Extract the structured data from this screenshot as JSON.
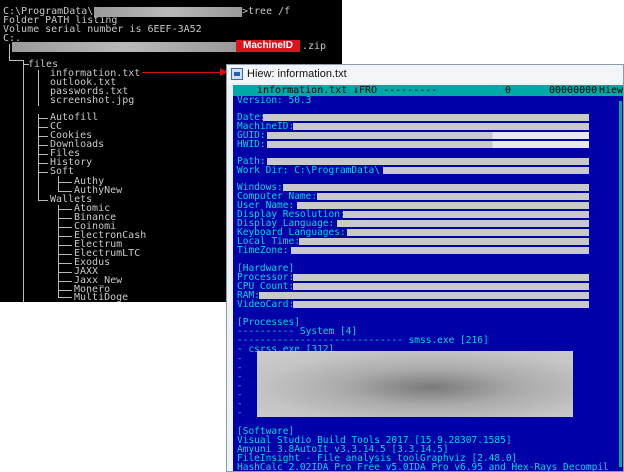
{
  "console": {
    "cmd_prefix": "C:\\ProgramData\\",
    "cmd_suffix": ">tree /f",
    "line1": "Folder PATH listing",
    "line2": "Volume serial number is 6EEF-3A52",
    "line3": "C:.",
    "zip_suffix": ".zip",
    "machineid_label": "MachineID",
    "tree": {
      "files": "files",
      "files_children": [
        "information.txt",
        "outlook.txt",
        "passwords.txt",
        "screenshot.jpg"
      ],
      "dirs": [
        "Autofill",
        "CC",
        "Cookies",
        "Downloads",
        "Files",
        "History",
        "Soft"
      ],
      "soft_children": [
        "Authy",
        "AuthyNew"
      ],
      "wallets": "Wallets",
      "wallets_children": [
        "Atomic",
        "Binance",
        "Coinomi",
        "ElectronCash",
        "Electrum",
        "ElectrumLTC",
        "Exodus",
        "JAXX",
        "Jaxx_New",
        "Monero",
        "MultiDoge"
      ]
    }
  },
  "hiew": {
    "window_title": "Hiew: information.txt",
    "status": {
      "filename": "information.txt",
      "mode": "↓FRO ---------",
      "zero": "0",
      "offset": "00000000",
      "app": "Hiew"
    },
    "version_line": "Version: 50.3",
    "date_label": "Date:",
    "machineid_label": "MachineID:",
    "guid_label": "GUID:",
    "hwid_label": "HWID:",
    "path_label": "Path:",
    "workdir_label": "Work Dir: C:\\ProgramData\\",
    "windows_label": "Windows:",
    "computer_label": "Computer Name:",
    "user_label": "User Name:",
    "resolution_label": "Display Resolution:",
    "language_label": "Display Language:",
    "keyboard_label": "Keyboard Languages:",
    "localtime_label": "Local Time:",
    "timezone_label": "TimeZone:",
    "hardware_header": "[Hardware]",
    "processor_label": "Processor:",
    "cpu_label": "CPU Count:",
    "ram_label": "RAM:",
    "videocard_label": "VideoCard:",
    "processes_header": "[Processes]",
    "system_line": "---------- System [4]",
    "smss_line": "----------------------------- smss.exe [216]",
    "csrss_line": "- csrss.exe [312]",
    "software_header": "[Software]",
    "software_lines": [
      "Visual Studio Build Tools 2017 [15.9.28307.1585]",
      "Amyuni 3.8AutoIt v3.3.14.5 [3.3.14.5]",
      "FileInsight - File analysis toolGraphviz [2.48.0]",
      "HashCalc 2.02IDA Pro Free v5.0IDA Pro v6.95 and Hex-Rays Decompil"
    ]
  }
}
